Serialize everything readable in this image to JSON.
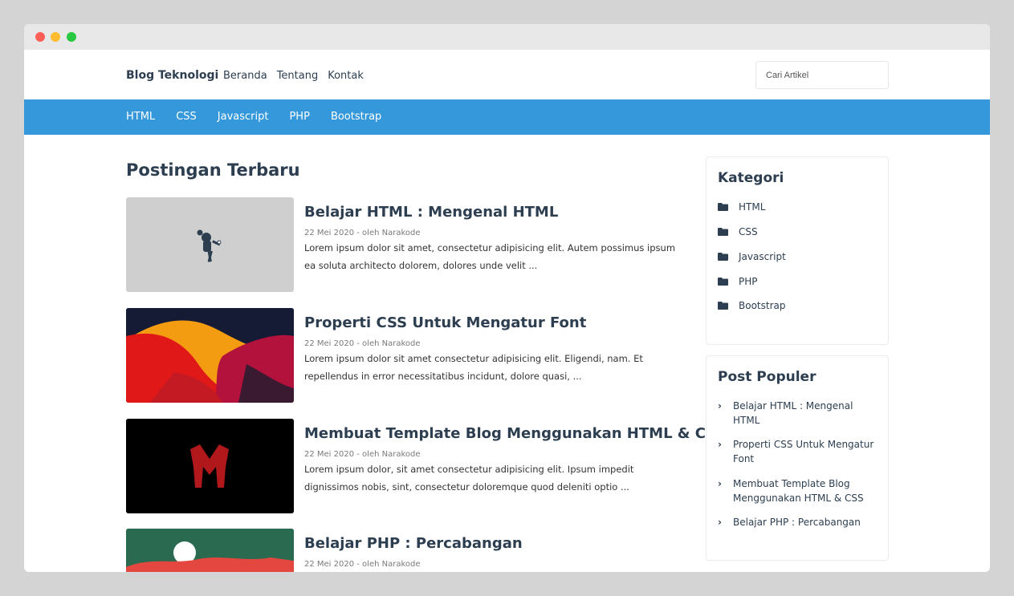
{
  "window": {
    "controls": [
      "close",
      "minimize",
      "maximize"
    ]
  },
  "topnav": {
    "brand": "Blog Teknologi",
    "links": [
      "Beranda",
      "Tentang",
      "Kontak"
    ],
    "search_placeholder": "Cari Artikel"
  },
  "catbar": {
    "links": [
      "HTML",
      "CSS",
      "Javascript",
      "PHP",
      "Bootstrap"
    ]
  },
  "main": {
    "section_title": "Postingan Terbaru",
    "posts": [
      {
        "title": "Belajar HTML : Mengenal HTML",
        "meta": "22 Mei 2020 - oleh Narakode",
        "excerpt": "Lorem ipsum dolor sit amet, consectetur adipisicing elit. Autem possimus ipsum ea soluta architecto dolorem, dolores unde velit ..."
      },
      {
        "title": "Properti CSS Untuk Mengatur Font",
        "meta": "22 Mei 2020 - oleh Narakode",
        "excerpt": "Lorem ipsum dolor sit amet consectetur adipisicing elit. Eligendi, nam. Et repellendus in error necessitatibus incidunt, dolore quasi, ..."
      },
      {
        "title": "Membuat Template Blog Menggunakan HTML & CSS",
        "meta": "22 Mei 2020 - oleh Narakode",
        "excerpt": "Lorem ipsum dolor, sit amet consectetur adipisicing elit. Ipsum impedit dignissimos nobis, sint, consectetur doloremque quod deleniti optio ..."
      },
      {
        "title": "Belajar PHP : Percabangan",
        "meta": "22 Mei 2020 - oleh Narakode",
        "excerpt": ""
      }
    ]
  },
  "sidebar": {
    "categories": {
      "title": "Kategori",
      "items": [
        "HTML",
        "CSS",
        "Javascript",
        "PHP",
        "Bootstrap"
      ]
    },
    "popular": {
      "title": "Post Populer",
      "items": [
        "Belajar HTML : Mengenal HTML",
        "Properti CSS Untuk Mengatur Font",
        "Membuat Template Blog Menggunakan HTML & CSS",
        "Belajar PHP : Percabangan"
      ]
    }
  },
  "colors": {
    "accent": "#3498db",
    "text": "#2c3e50",
    "muted": "#7a7a7a"
  },
  "icons": {
    "category": "folder-icon",
    "popular": "chevron-right-icon"
  }
}
